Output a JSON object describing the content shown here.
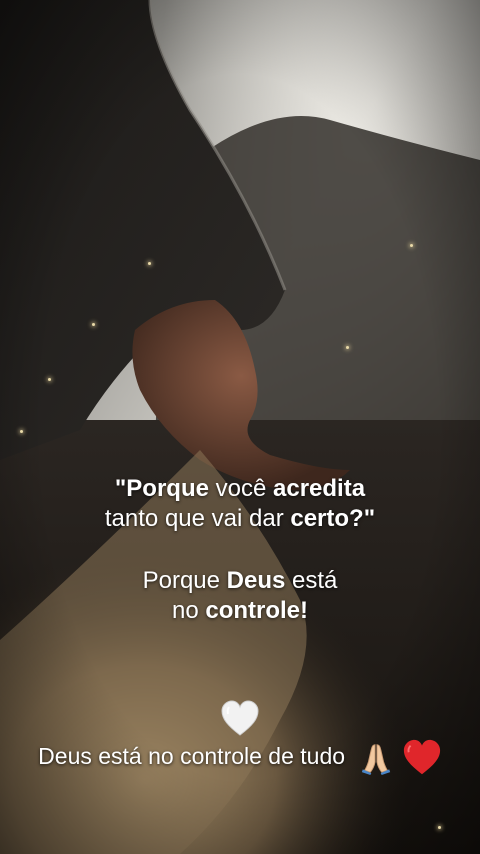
{
  "quote": {
    "q1_bold": "\"Porque",
    "q1_light": "você",
    "q1_bold2": "acredita",
    "q2_light": "tanto que vai dar",
    "q2_bold": "certo?\"",
    "a1_light": "Porque",
    "a1_bold": "Deus",
    "a1_light2": "está",
    "a2_light": "no",
    "a2_bold": "controle!"
  },
  "caption": {
    "text": "Deus está no controle de tudo"
  },
  "icons": {
    "top_heart": "white-heart-icon",
    "praying": "praying-hands-icon",
    "red_heart": "red-heart-icon"
  },
  "colors": {
    "white_heart": "#f2f2f2",
    "red_heart": "#e0262b",
    "skin": "#f2c9a0"
  }
}
